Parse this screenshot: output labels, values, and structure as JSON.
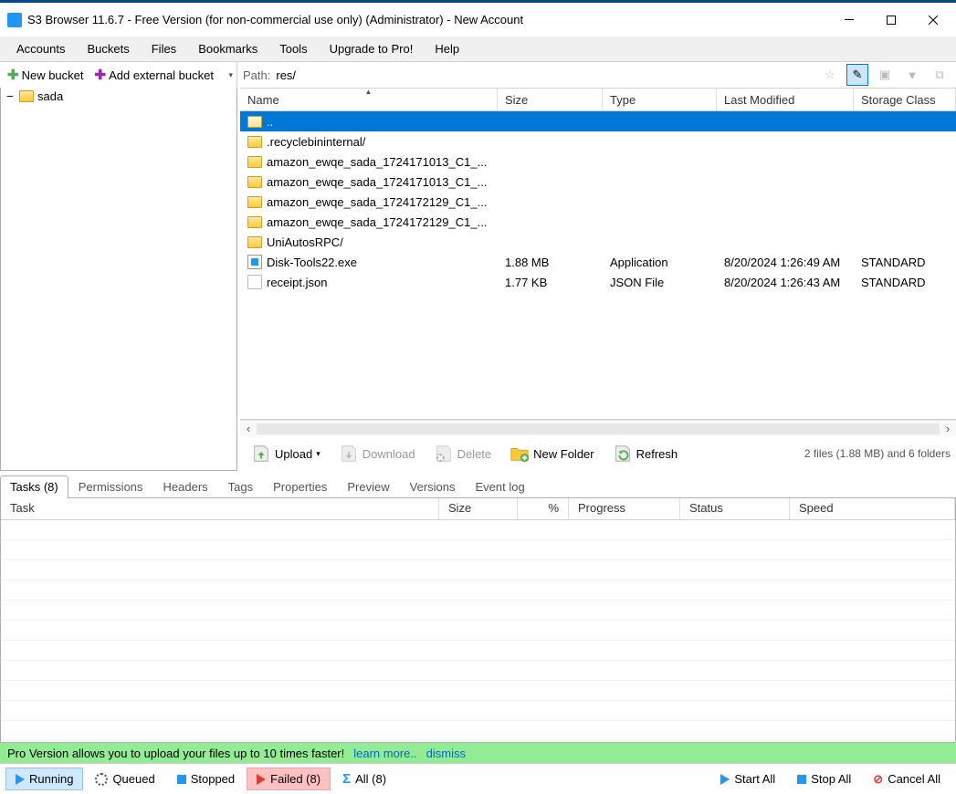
{
  "window": {
    "title": "S3 Browser 11.6.7 - Free Version (for non-commercial use only) (Administrator) - New Account"
  },
  "menu": {
    "items": [
      "Accounts",
      "Buckets",
      "Files",
      "Bookmarks",
      "Tools",
      "Upgrade to Pro!",
      "Help"
    ]
  },
  "toolbar": {
    "new_bucket": "New bucket",
    "add_external_bucket": "Add external bucket",
    "path_label": "Path:",
    "path_value": "res/"
  },
  "tree": {
    "root": "sada"
  },
  "file_columns": {
    "name": "Name",
    "size": "Size",
    "type": "Type",
    "last_modified": "Last Modified",
    "storage_class": "Storage Class"
  },
  "files": [
    {
      "icon": "folder-open",
      "name": "..",
      "size": "",
      "type": "",
      "lm": "",
      "sc": "",
      "selected": true
    },
    {
      "icon": "folder",
      "name": ".recyclebininternal/",
      "size": "",
      "type": "",
      "lm": "",
      "sc": ""
    },
    {
      "icon": "folder",
      "name": "amazon_ewqe_sada_1724171013_C1_...",
      "size": "",
      "type": "",
      "lm": "",
      "sc": ""
    },
    {
      "icon": "folder",
      "name": "amazon_ewqe_sada_1724171013_C1_...",
      "size": "",
      "type": "",
      "lm": "",
      "sc": ""
    },
    {
      "icon": "folder",
      "name": "amazon_ewqe_sada_1724172129_C1_...",
      "size": "",
      "type": "",
      "lm": "",
      "sc": ""
    },
    {
      "icon": "folder",
      "name": "amazon_ewqe_sada_1724172129_C1_...",
      "size": "",
      "type": "",
      "lm": "",
      "sc": ""
    },
    {
      "icon": "folder",
      "name": "UniAutosRPC/",
      "size": "",
      "type": "",
      "lm": "",
      "sc": ""
    },
    {
      "icon": "exe",
      "name": "Disk-Tools22.exe",
      "size": "1.88 MB",
      "type": "Application",
      "lm": "8/20/2024 1:26:49 AM",
      "sc": "STANDARD"
    },
    {
      "icon": "doc",
      "name": "receipt.json",
      "size": "1.77 KB",
      "type": "JSON File",
      "lm": "8/20/2024 1:26:43 AM",
      "sc": "STANDARD"
    }
  ],
  "actions": {
    "upload": "Upload",
    "download": "Download",
    "delete": "Delete",
    "new_folder": "New Folder",
    "refresh": "Refresh",
    "summary": "2 files (1.88 MB) and 6 folders"
  },
  "bottom_tabs": [
    "Tasks (8)",
    "Permissions",
    "Headers",
    "Tags",
    "Properties",
    "Preview",
    "Versions",
    "Event log"
  ],
  "task_columns": {
    "task": "Task",
    "size": "Size",
    "percent": "%",
    "progress": "Progress",
    "status": "Status",
    "speed": "Speed"
  },
  "promo": {
    "text": "Pro Version allows you to upload your files up to 10 times faster!",
    "learn": "learn more..",
    "dismiss": "dismiss"
  },
  "status_tabs": {
    "running": "Running",
    "queued": "Queued",
    "stopped": "Stopped",
    "failed": "Failed (8)",
    "all": "All (8)",
    "start_all": "Start All",
    "stop_all": "Stop All",
    "cancel_all": "Cancel All"
  }
}
